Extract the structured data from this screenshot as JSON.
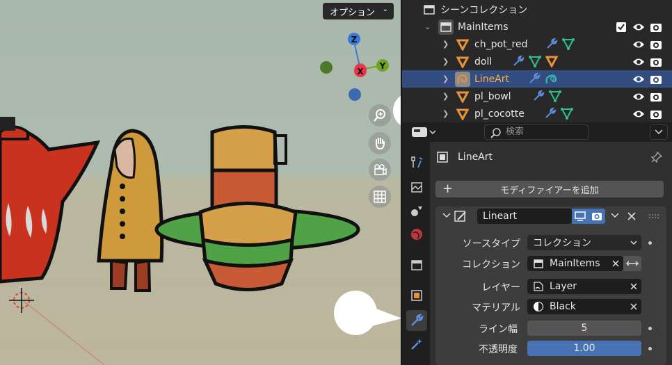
{
  "viewport": {
    "options_label": "オプション",
    "gizmo": {
      "z": "Z",
      "x": "X",
      "y": "Y"
    }
  },
  "outliner": {
    "scene_collection": "シーンコレクション",
    "rows": [
      {
        "label": "MainItems"
      },
      {
        "label": "ch_pot_red"
      },
      {
        "label": "doll"
      },
      {
        "label": "LineArt"
      },
      {
        "label": "pl_bowl"
      },
      {
        "label": "pl_cocotte"
      }
    ]
  },
  "properties": {
    "search_placeholder": "検索",
    "object_name": "LineArt",
    "add_modifier_label": "モディファイアーを追加",
    "modifier_name": "Lineart",
    "fields": {
      "source_type_label": "ソースタイプ",
      "source_type_value": "コレクション",
      "collection_label": "コレクション",
      "collection_value": "MainItems",
      "layer_label": "レイヤー",
      "layer_value": "Layer",
      "material_label": "マテリアル",
      "material_value": "Black",
      "line_width_label": "ライン幅",
      "line_width_value": "5",
      "opacity_label": "不透明度",
      "opacity_value": "1.00"
    }
  },
  "colors": {
    "accent_selected": "#334d80",
    "active_label": "#ffae45",
    "opacity_fill": "#4772b3"
  }
}
